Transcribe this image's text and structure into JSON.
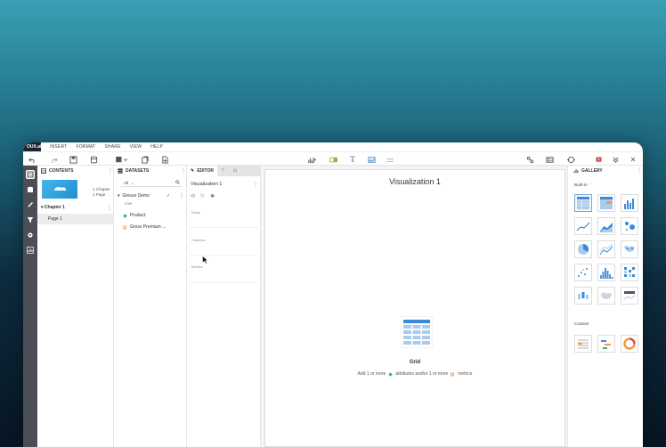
{
  "menu": {
    "logo": "OUX.ai",
    "items": [
      "INSERT",
      "FORMAT",
      "SHARE",
      "VIEW",
      "HELP"
    ]
  },
  "toolbar": {
    "left_icons": [
      "undo-icon",
      "redo-icon",
      "save-icon",
      "data-icon",
      "dataset-icon",
      "filter-icon",
      "add-page-icon"
    ],
    "center_icons": [
      "chart-add-icon",
      "filter-toggle-icon",
      "text-icon",
      "image-icon",
      "shape-icon"
    ],
    "right_icons": [
      "graph-icon",
      "grid-icon",
      "target-icon",
      "warning-icon",
      "collapse-icon",
      "close-icon"
    ]
  },
  "colors": {
    "accent": "#4a90d9",
    "rail": "#4b4f55",
    "attribute": "#3aa878",
    "metric": "#f2994a"
  },
  "contents": {
    "header": "CONTENTS",
    "thumb_line1": "1 Chapter",
    "thumb_line2": "1 Page",
    "chapter": "Chapter 1",
    "page": "Page 1"
  },
  "datasets": {
    "header": "DATASETS",
    "filter": "All",
    "name": "Ginsus Demo",
    "sub": "Live",
    "items": [
      {
        "label": "Product",
        "icon": "attribute-icon"
      },
      {
        "label": "Gross Premium ...",
        "icon": "metric-icon"
      }
    ]
  },
  "editor": {
    "tab": "EDITOR",
    "viz_name": "Visualization 1",
    "zones": [
      "Rows",
      "Columns",
      "Metrics"
    ]
  },
  "canvas": {
    "title": "Visualization 1",
    "placeholder_label": "Grid",
    "hint_prefix": "Add 1 or more",
    "hint_attr": "attributes and/or 1 or more",
    "hint_metric": "metrics"
  },
  "gallery": {
    "header": "GALLERY",
    "builtin_label": "Built-in",
    "custom_label": "Custom"
  }
}
